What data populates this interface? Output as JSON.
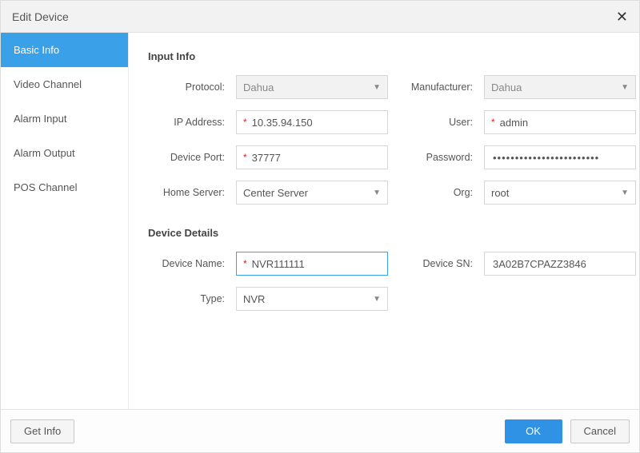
{
  "dialog": {
    "title": "Edit Device"
  },
  "sidebar": {
    "items": [
      {
        "label": "Basic Info"
      },
      {
        "label": "Video Channel"
      },
      {
        "label": "Alarm Input"
      },
      {
        "label": "Alarm Output"
      },
      {
        "label": "POS Channel"
      }
    ]
  },
  "sections": {
    "input_info": {
      "title": "Input Info",
      "protocol_label": "Protocol:",
      "protocol_value": "Dahua",
      "manufacturer_label": "Manufacturer:",
      "manufacturer_value": "Dahua",
      "ip_label": "IP Address:",
      "ip_value": "10.35.94.150",
      "user_label": "User:",
      "user_value": "admin",
      "port_label": "Device Port:",
      "port_value": "37777",
      "password_label": "Password:",
      "password_value": "••••••••••••••••••••••••",
      "home_server_label": "Home Server:",
      "home_server_value": "Center Server",
      "org_label": "Org:",
      "org_value": "root"
    },
    "device_details": {
      "title": "Device Details",
      "device_name_label": "Device Name:",
      "device_name_value": "NVR111111",
      "device_sn_label": "Device SN:",
      "device_sn_value": "3A02B7CPAZZ3846",
      "type_label": "Type:",
      "type_value": "NVR"
    }
  },
  "footer": {
    "get_info": "Get Info",
    "ok": "OK",
    "cancel": "Cancel"
  }
}
